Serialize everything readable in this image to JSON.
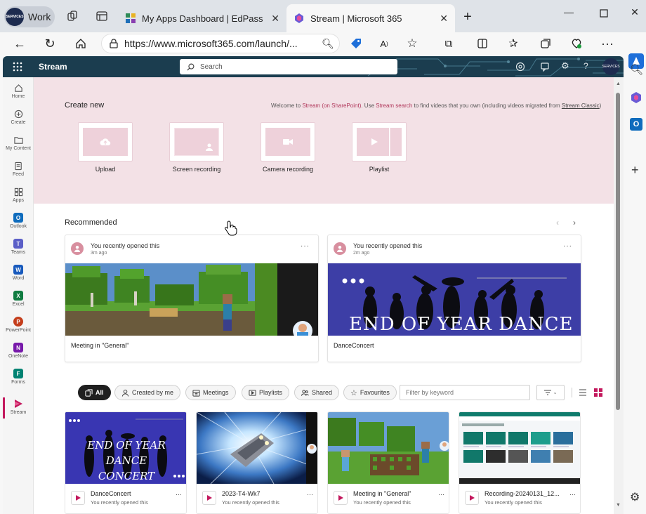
{
  "browser": {
    "profile_label": "Work",
    "profile_avatar_text": "SERVICES",
    "tabs": [
      {
        "title": "My Apps Dashboard | EdPass - Ec",
        "active": false
      },
      {
        "title": "Stream | Microsoft 365",
        "active": true
      }
    ],
    "url": "https://www.microsoft365.com/launch/..."
  },
  "suite": {
    "app_name": "Stream",
    "search_placeholder": "Search",
    "avatar_text": "SERVICES"
  },
  "rail": {
    "items": [
      {
        "label": "Home"
      },
      {
        "label": "Create"
      },
      {
        "label": "My Content"
      },
      {
        "label": "Feed"
      },
      {
        "label": "Apps"
      },
      {
        "label": "Outlook",
        "letter": "O",
        "color": "#0f6cbd"
      },
      {
        "label": "Teams",
        "letter": "T",
        "color": "#5b5fc7"
      },
      {
        "label": "Word",
        "letter": "W",
        "color": "#185abd"
      },
      {
        "label": "Excel",
        "letter": "X",
        "color": "#107c41"
      },
      {
        "label": "PowerPoint",
        "letter": "P",
        "color": "#c43e1c"
      },
      {
        "label": "OneNote",
        "letter": "N",
        "color": "#7719aa"
      },
      {
        "label": "Forms",
        "letter": "F",
        "color": "#008272"
      },
      {
        "label": "Stream",
        "letter": "",
        "color": "#c3185d"
      }
    ]
  },
  "hero": {
    "title": "Create new",
    "welcome_prefix": "Welcome to ",
    "welcome_link1": "Stream (on SharePoint)",
    "welcome_mid": ". Use ",
    "welcome_link2": "Stream search",
    "welcome_suffix": " to find videos that you own (including videos migrated from ",
    "welcome_link3": "Stream Classic",
    "welcome_end": ")",
    "create_options": [
      {
        "label": "Upload"
      },
      {
        "label": "Screen recording"
      },
      {
        "label": "Camera recording"
      },
      {
        "label": "Playlist"
      }
    ]
  },
  "recommended": {
    "title": "Recommended",
    "cards": [
      {
        "opened": "You recently opened this",
        "ago": "3m ago",
        "name": "Meeting in \"General\"",
        "thumb": "minecraft"
      },
      {
        "opened": "You recently opened this",
        "ago": "2m ago",
        "name": "DanceConcert",
        "thumb": "dance",
        "thumb_text": "END OF YEAR DANCE"
      }
    ]
  },
  "filters": {
    "chips": [
      {
        "label": "All",
        "selected": true
      },
      {
        "label": "Created by me",
        "selected": false
      },
      {
        "label": "Meetings",
        "selected": false
      },
      {
        "label": "Playlists",
        "selected": false
      },
      {
        "label": "Shared",
        "selected": false
      },
      {
        "label": "Favourites",
        "selected": false
      }
    ],
    "keyword_placeholder": "Filter by keyword"
  },
  "videos": [
    {
      "title": "DanceConcert",
      "sub": "You recently opened this",
      "thumb": "dance",
      "thumb_text_1": "END OF YEAR DANCE",
      "thumb_text_2": "CONCERT"
    },
    {
      "title": "2023-T4-Wk7",
      "sub": "You recently opened this",
      "thumb": "space"
    },
    {
      "title": "Meeting in \"General\"",
      "sub": "You recently opened this",
      "thumb": "minecraft"
    },
    {
      "title": "Recording-20240131_12...",
      "sub": "You recently opened this",
      "thumb": "screen"
    }
  ],
  "colors": {
    "accent": "#c3185d",
    "suite_bar": "#1b3d4f",
    "hero_bg": "#f3e1e6",
    "thumb_pink": "#eed1da"
  }
}
